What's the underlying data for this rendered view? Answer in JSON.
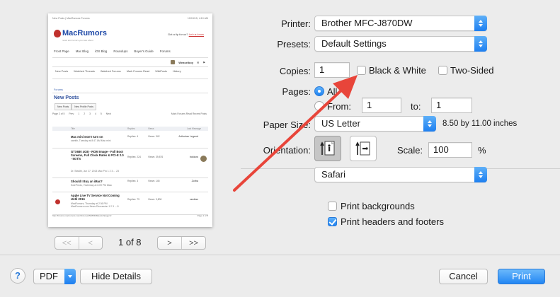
{
  "preview": {
    "header_left": "New Posts | MacRumors Forums",
    "header_right": "10/15/15, 4:10 AM",
    "logo_text": "MacRumors",
    "tagline": "news and rumors you care about",
    "tip_text": "Got a tip for us?",
    "tip_link": "Let us know",
    "nav": [
      "Front Page",
      "Mac Blog",
      "iOS Blog",
      "Roundups",
      "Buyer's Guide",
      "Forums"
    ],
    "username": "Weaselboy",
    "subnav": [
      "New Posts",
      "Watched Threads",
      "Watched Forums",
      "Mark Forums Read",
      "WikiPosts",
      "History"
    ],
    "forums_label": "Forums",
    "page_title": "New Posts",
    "tabs": [
      "New Posts",
      "New Profile Posts"
    ],
    "pager": [
      "Page 2 of 5",
      "Prev",
      "1",
      "2",
      "3",
      "4",
      "5",
      "Next"
    ],
    "pager_right": "Mark Forums Read  Recent Posts",
    "col_headers": [
      "Title",
      "Replies",
      "Views",
      "Last Message"
    ],
    "rows": [
      {
        "title": "Mac mini won't turn on",
        "meta": "samtib, Tuesday at 8:47 AM  Mac mini",
        "replies": "Replies: 4",
        "views": "Views: 342",
        "user": "Arthurian Legend"
      },
      {
        "title": "GTX680 4GB - ROM Image - Full Boot Screens, Full Clock Rates & PCI-E 2.0 - 5GT/s",
        "meta": "Dr. Stealth, Jun 27, 2013  Mac Pro  1 2 3 ... 23",
        "replies": "Replies: 224",
        "views": "Views: 39,876",
        "user": "bokkow"
      },
      {
        "title": "Should I Buy an iMac?",
        "meta": "SolePredo, Yesterday at 6:09 PM  iMac",
        "replies": "Replies: 3",
        "views": "Views: 145",
        "user": "Zorba"
      },
      {
        "title": "Apple Live TV Service Not Coming Until 2016",
        "meta": "MacRumors, Thursday at 2:36 PM  MacRumors.com News Discussion  1 2 3 ... 8",
        "replies": "Replies: 79",
        "views": "Views: 3,800",
        "user": "randian"
      }
    ],
    "footer_left": "http://forums.macrumors.com/find-new/5485438/posts?page=2",
    "footer_right": "Page 1 of 8"
  },
  "page_controls": {
    "first": "<<",
    "prev": "<",
    "page_of": "1 of 8",
    "next": ">",
    "last": ">>"
  },
  "form": {
    "printer_label": "Printer:",
    "printer_value": "Brother MFC-J870DW",
    "presets_label": "Presets:",
    "presets_value": "Default Settings",
    "copies_label": "Copies:",
    "copies_value": "1",
    "bw_label": "Black & White",
    "bw_checked": false,
    "twosided_label": "Two-Sided",
    "twosided_checked": false,
    "pages_label": "Pages:",
    "pages_all_label": "All",
    "pages_from_label": "From:",
    "from_value": "1",
    "to_label": "to:",
    "to_value": "1",
    "papersize_label": "Paper Size:",
    "papersize_value": "US Letter",
    "papersize_dims": "8.50 by 11.00 inches",
    "orientation_label": "Orientation:",
    "scale_label": "Scale:",
    "scale_value": "100",
    "scale_unit": "%",
    "app_section": "Safari",
    "print_backgrounds_label": "Print backgrounds",
    "print_backgrounds_checked": false,
    "print_headers_label": "Print headers and footers",
    "print_headers_checked": true
  },
  "bottom": {
    "help": "?",
    "pdf": "PDF",
    "hide_details": "Hide Details",
    "cancel": "Cancel",
    "print": "Print"
  },
  "colors": {
    "accent": "#1e7ff0",
    "annotation_arrow": "#e8453a",
    "dialog_bg": "#ececec"
  }
}
